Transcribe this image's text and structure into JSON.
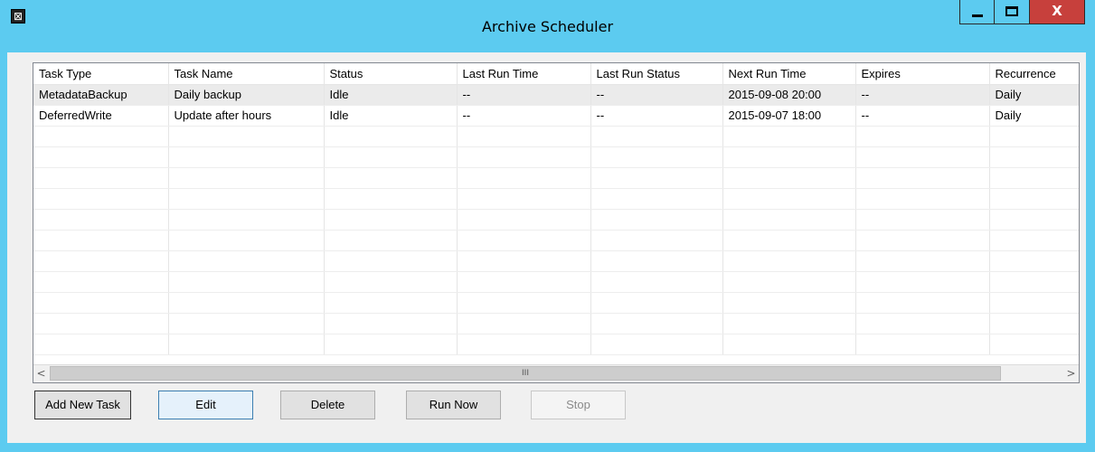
{
  "window": {
    "title": "Archive Scheduler",
    "app_icon_glyph": "⊠",
    "close_glyph": "X"
  },
  "table": {
    "columns": [
      "Task Type",
      "Task Name",
      "Status",
      "Last Run Time",
      "Last Run Status",
      "Next Run Time",
      "Expires",
      "Recurrence"
    ],
    "rows": [
      [
        "MetadataBackup",
        "Daily backup",
        "Idle",
        "--",
        "--",
        "2015-09-08 20:00",
        "--",
        "Daily"
      ],
      [
        "DeferredWrite",
        "Update after hours",
        "Idle",
        "--",
        "--",
        "2015-09-07 18:00",
        "--",
        "Daily"
      ]
    ],
    "selected_row": 0
  },
  "scrollbar": {
    "left_arrow": "<",
    "right_arrow": ">",
    "thumb_grip": "III"
  },
  "buttons": {
    "add": "Add New Task",
    "edit": "Edit",
    "delete": "Delete",
    "run_now": "Run Now",
    "stop": "Stop"
  },
  "colors": {
    "titlebar": "#5ccbf0",
    "close": "#c7403c"
  }
}
